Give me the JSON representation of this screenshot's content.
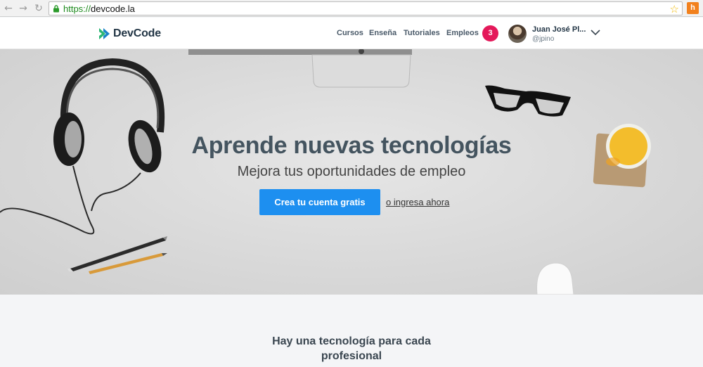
{
  "browser": {
    "back": "←",
    "forward": "→",
    "reload": "↻",
    "url_scheme": "https://",
    "url_host": "devcode.la",
    "star": "☆",
    "extension": "h"
  },
  "header": {
    "logo_text": "DevCode",
    "nav": [
      "Cursos",
      "Enseña",
      "Tutoriales",
      "Empleos"
    ],
    "notification_count": "3",
    "user_name": "Juan José Pl...",
    "user_handle": "@jpino"
  },
  "hero": {
    "title": "Aprende nuevas tecnologías",
    "subtitle": "Mejora tus oportunidades de empleo",
    "cta_label": "Crea tu cuenta gratis",
    "login_label": "o ingresa ahora"
  },
  "section": {
    "title": "Hay una tecnología para cada profesional"
  },
  "colors": {
    "brand_dark": "#233646",
    "brand_green": "#2ab673",
    "cta_blue": "#1d8ff0",
    "badge_pink": "#e4195a"
  }
}
